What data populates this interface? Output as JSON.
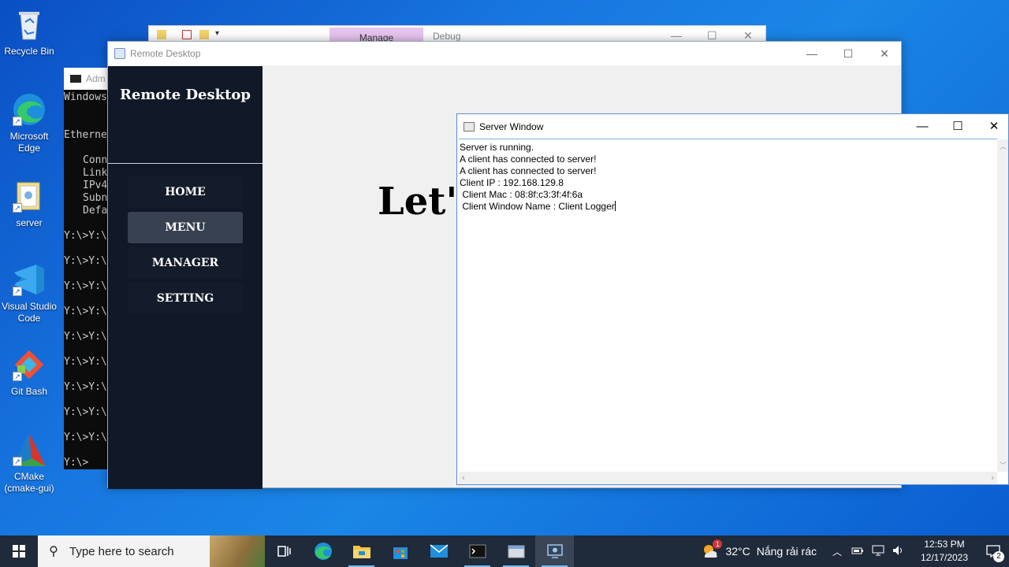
{
  "desktop": {
    "icons": [
      {
        "label": "Recycle Bin"
      },
      {
        "label": "Microsoft Edge"
      },
      {
        "label": "server"
      },
      {
        "label": "Visual Studio Code"
      },
      {
        "label": "Git Bash"
      },
      {
        "label": "CMake (cmake-gui)"
      }
    ]
  },
  "explorer": {
    "tab_manage": "Manage",
    "tab_debug": "Debug"
  },
  "console": {
    "title": "Adm",
    "lines": [
      "Windows",
      "Etherne",
      "Conn",
      "Link",
      "IPv4",
      "Subn",
      "Defa",
      "Y:\\>Y:\\",
      "Y:\\>Y:\\",
      "Y:\\>Y:\\",
      "Y:\\>Y:\\",
      "Y:\\>Y:\\",
      "Y:\\>Y:\\",
      "Y:\\>Y:\\",
      "Y:\\>Y:\\",
      "Y:\\>Y:\\",
      "Y:\\>"
    ]
  },
  "remote_desktop": {
    "window_title": "Remote Desktop",
    "brand": "Remote Desktop",
    "nav": [
      {
        "label": "HOME",
        "active": false
      },
      {
        "label": "MENU",
        "active": true
      },
      {
        "label": "MANAGER",
        "active": false
      },
      {
        "label": "SETTING",
        "active": false
      }
    ],
    "heading": "Let's"
  },
  "server_window": {
    "title": "Server Window",
    "log": [
      "Server is running.",
      "A client has connected to server!",
      "A client has connected to server!",
      "Client IP : 192.168.129.8",
      " Client Mac : 08:8f:c3:3f:4f:6a",
      " Client Window Name : Client Logger"
    ]
  },
  "taskbar": {
    "search_placeholder": "Type here to search",
    "weather_temp": "32°C",
    "weather_desc": "Nắng rải rác",
    "weather_badge": "1",
    "time": "12:53 PM",
    "date": "12/17/2023",
    "notification_count": "2"
  }
}
